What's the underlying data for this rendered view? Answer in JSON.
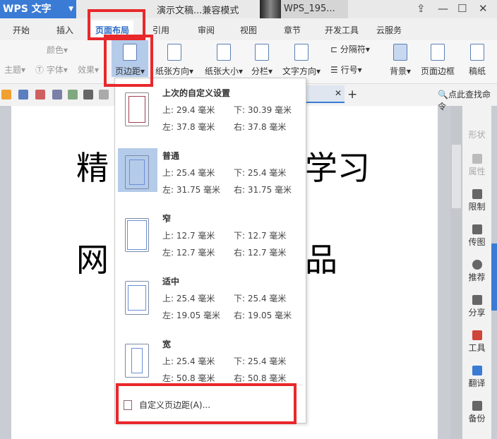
{
  "app": {
    "logo": "WPS 文字",
    "doc_title": "演示文稿...兼容模式",
    "user": "WPS_195..."
  },
  "tabs": [
    "开始",
    "插入",
    "页面布局",
    "引用",
    "审阅",
    "视图",
    "章节",
    "开发工具",
    "云服务"
  ],
  "active_tab": "页面布局",
  "ribbon": {
    "theme": "主题",
    "color": "颜色",
    "font": "字体",
    "effect": "效果",
    "margins": "页边距",
    "orientation": "纸张方向",
    "size": "纸张大小",
    "columns": "分栏",
    "text_direction": "文字方向",
    "breaks": "分隔符",
    "line_numbers": "行号",
    "background": "背景",
    "page_border": "页面边框",
    "manuscript": "稿纸"
  },
  "search": "点此查找命令",
  "document": {
    "line1_left": "精",
    "line1_right": "学习",
    "line2_left": "网",
    "line2_right": "品"
  },
  "sidebar": [
    "形状",
    "属性",
    "限制",
    "传图",
    "推荐",
    "分享",
    "工具",
    "翻译",
    "备份"
  ],
  "margin_menu": {
    "items": [
      {
        "name": "上次的自定义设置",
        "top": "上: 29.4 毫米",
        "bottom": "下: 30.39 毫米",
        "left": "左: 37.8 毫米",
        "right": "右: 37.8 毫米"
      },
      {
        "name": "普通",
        "top": "上: 25.4 毫米",
        "bottom": "下: 25.4 毫米",
        "left": "左: 31.75 毫米",
        "right": "右: 31.75 毫米"
      },
      {
        "name": "窄",
        "top": "上: 12.7 毫米",
        "bottom": "下: 12.7 毫米",
        "left": "左: 12.7 毫米",
        "right": "右: 12.7 毫米"
      },
      {
        "name": "适中",
        "top": "上: 25.4 毫米",
        "bottom": "下: 25.4 毫米",
        "left": "左: 19.05 毫米",
        "right": "右: 19.05 毫米"
      },
      {
        "name": "宽",
        "top": "上: 25.4 毫米",
        "bottom": "下: 25.4 毫米",
        "left": "左: 50.8 毫米",
        "right": "右: 50.8 毫米"
      }
    ],
    "custom": "自定义页边距(A)..."
  },
  "colors": {
    "accent": "#3a7bd5",
    "highlight": "#e8282b"
  }
}
